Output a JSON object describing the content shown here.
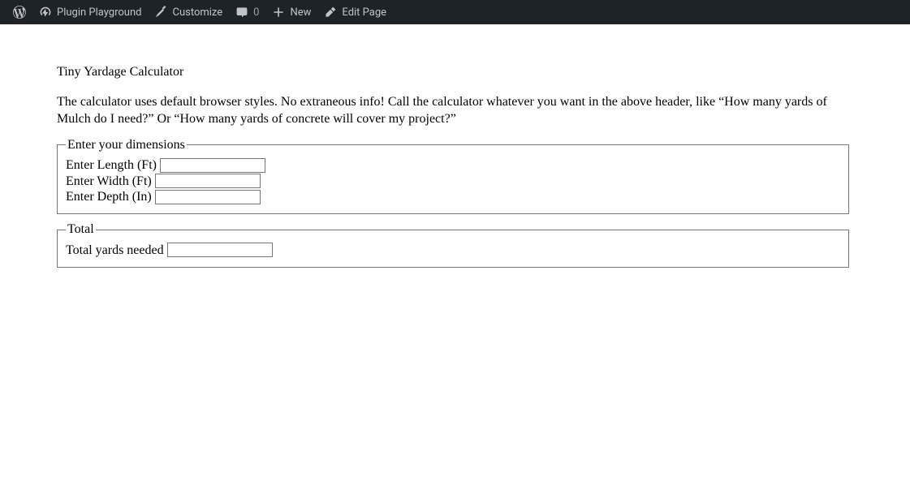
{
  "adminBar": {
    "siteTitle": "Plugin Playground",
    "customize": "Customize",
    "commentCount": "0",
    "newLabel": "New",
    "editPage": "Edit Page"
  },
  "page": {
    "title": "Tiny Yardage Calculator",
    "description": "The calculator uses default browser styles. No extraneous info! Call the calculator whatever you want in the above header, like “How many yards of Mulch do I need?” Or “How many yards of concrete will cover my project?”"
  },
  "calculator": {
    "dimensionsLegend": "Enter your dimensions",
    "lengthLabel": "Enter Length (Ft)",
    "lengthValue": "",
    "widthLabel": "Enter Width (Ft)",
    "widthValue": "",
    "depthLabel": "Enter Depth (In)",
    "depthValue": "",
    "totalLegend": "Total",
    "totalLabel": "Total yards needed",
    "totalValue": ""
  }
}
